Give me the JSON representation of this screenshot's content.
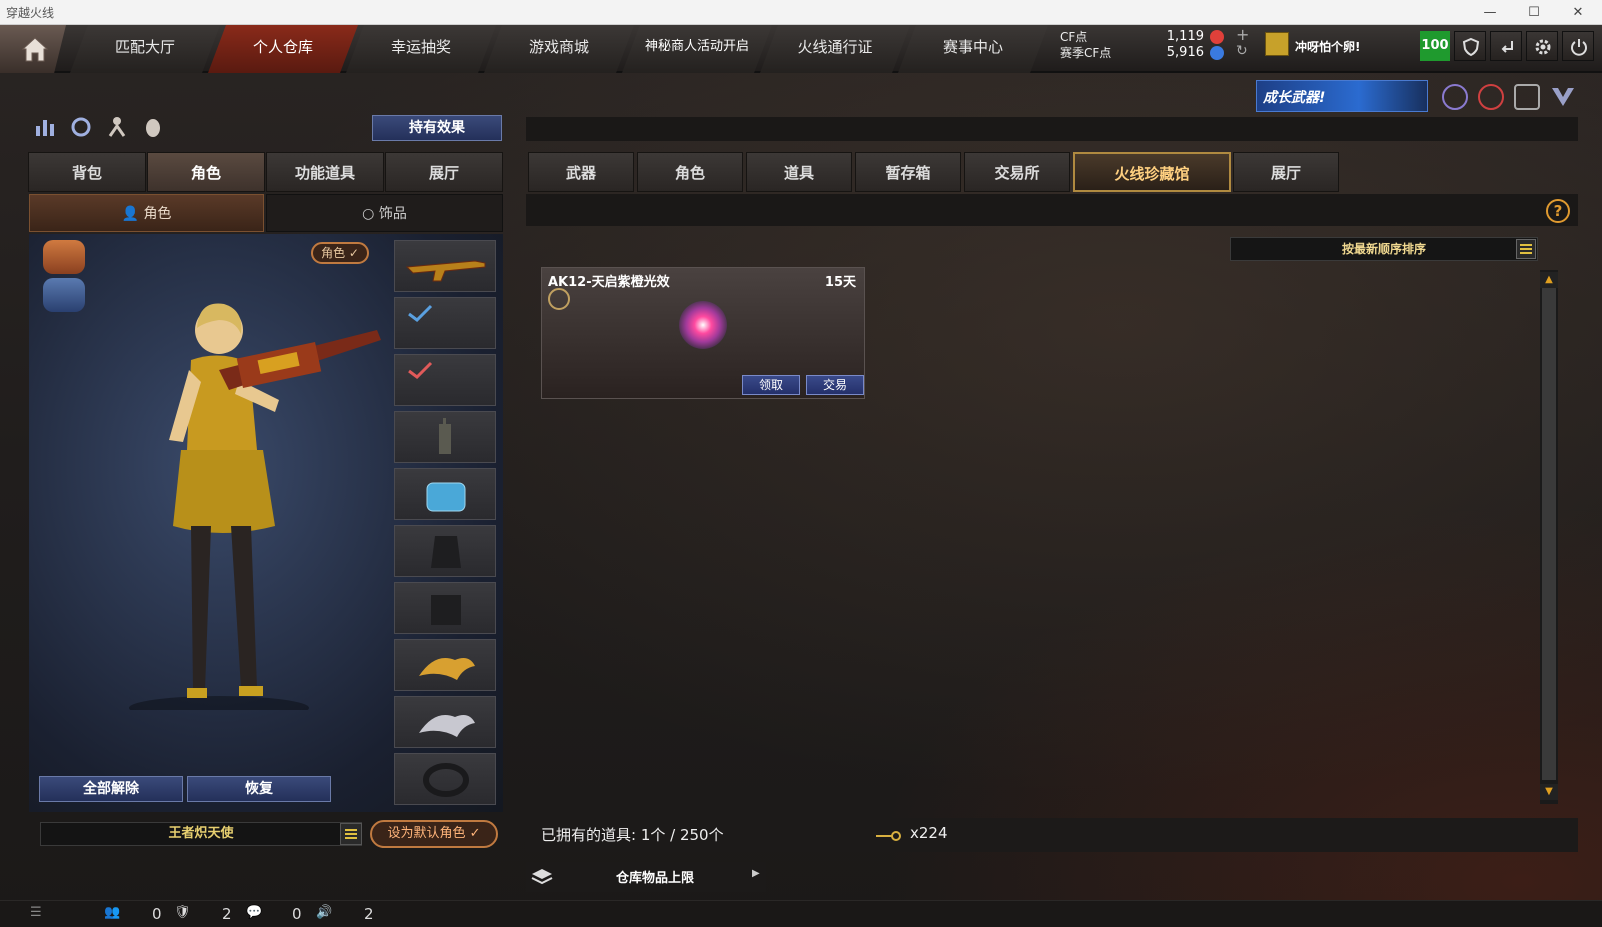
{
  "window": {
    "title": "穿越火线"
  },
  "topnav": {
    "tabs": [
      "匹配大厅",
      "个人仓库",
      "幸运抽奖",
      "游戏商城",
      "神秘商人活动开启",
      "火线通行证",
      "赛事中心"
    ],
    "cf_label": "CF点",
    "season_cf_label": "赛季CF点",
    "cf_value": "1,119",
    "season_cf_value": "5,916",
    "nickname": "冲呀怕个卵!",
    "level": "100"
  },
  "banner": {
    "text": "成长武器!"
  },
  "left": {
    "hold_effect": "持有效果",
    "tabs": [
      "背包",
      "角色",
      "功能道具",
      "展厅"
    ],
    "subtabs": [
      "角色",
      "饰品"
    ],
    "char_badge": "角色 ✓",
    "clear_all": "全部解除",
    "restore": "恢复",
    "character_name": "王者炽天使",
    "set_default": "设为默认角色 ✓"
  },
  "right": {
    "tabs": [
      "武器",
      "角色",
      "道具",
      "暂存箱",
      "交易所",
      "火线珍藏馆",
      "展厅"
    ],
    "sort_label": "按最新顺序排序",
    "item": {
      "title": "AK12-天启紫橙光效",
      "days": "15天",
      "claim": "领取",
      "trade": "交易"
    },
    "owned_text": "已拥有的道具:  1个 / 250个",
    "key_count": "x224",
    "capacity_label": "仓库物品上限"
  },
  "statusbar": {
    "v1": "0",
    "v2": "2",
    "v3": "0",
    "v4": "2"
  },
  "colors": {
    "accent_active": "#8a2a1a",
    "gold": "#b08a40",
    "level_green": "#1f9a2e"
  }
}
